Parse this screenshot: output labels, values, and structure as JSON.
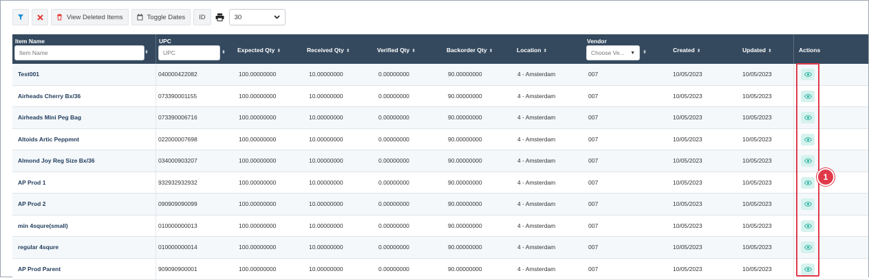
{
  "toolbar": {
    "filter_icon": "filter-icon",
    "clear_icon": "close-icon",
    "view_deleted_label": "View Deleted Items",
    "toggle_dates_label": "Toggle Dates",
    "id_label": "ID",
    "page_size_value": "30"
  },
  "columns": {
    "item_name": "Item Name",
    "item_name_placeholder": "Item Name",
    "upc": "UPC",
    "upc_placeholder": "UPC",
    "expected_qty": "Expected Qty",
    "received_qty": "Received Qty",
    "verified_qty": "Verified Qty",
    "backorder_qty": "Backorder Qty",
    "location": "Location",
    "vendor": "Vendor",
    "vendor_placeholder": "Choose Ve...",
    "created": "Created",
    "updated": "Updated",
    "actions": "Actions"
  },
  "rows": [
    {
      "name": "Test001",
      "upc": "040000422082",
      "expected": "100.00000000",
      "received": "10.00000000",
      "verified": "0.00000000",
      "backorder": "90.00000000",
      "location": "4 - Amsterdam",
      "vendor": "007",
      "created": "10/05/2023",
      "updated": "10/05/2023"
    },
    {
      "name": "Airheads Cherry Bx/36",
      "upc": "073390001155",
      "expected": "100.00000000",
      "received": "10.00000000",
      "verified": "0.00000000",
      "backorder": "90.00000000",
      "location": "4 - Amsterdam",
      "vendor": "007",
      "created": "10/05/2023",
      "updated": "10/05/2023"
    },
    {
      "name": "Airheads Mini Peg Bag",
      "upc": "073390006716",
      "expected": "100.00000000",
      "received": "10.00000000",
      "verified": "0.00000000",
      "backorder": "90.00000000",
      "location": "4 - Amsterdam",
      "vendor": "007",
      "created": "10/05/2023",
      "updated": "10/05/2023"
    },
    {
      "name": "Altoids Artic Peppmnt",
      "upc": "022000007698",
      "expected": "100.00000000",
      "received": "10.00000000",
      "verified": "0.00000000",
      "backorder": "90.00000000",
      "location": "4 - Amsterdam",
      "vendor": "007",
      "created": "10/05/2023",
      "updated": "10/05/2023"
    },
    {
      "name": "Almond Joy Reg Size Bx/36",
      "upc": "034000903207",
      "expected": "100.00000000",
      "received": "10.00000000",
      "verified": "0.00000000",
      "backorder": "90.00000000",
      "location": "4 - Amsterdam",
      "vendor": "007",
      "created": "10/05/2023",
      "updated": "10/05/2023"
    },
    {
      "name": "AP Prod 1",
      "upc": "932932932932",
      "expected": "100.00000000",
      "received": "10.00000000",
      "verified": "0.00000000",
      "backorder": "90.00000000",
      "location": "4 - Amsterdam",
      "vendor": "007",
      "created": "10/05/2023",
      "updated": "10/05/2023"
    },
    {
      "name": "AP Prod 2",
      "upc": "090909090099",
      "expected": "100.00000000",
      "received": "10.00000000",
      "verified": "0.00000000",
      "backorder": "90.00000000",
      "location": "4 - Amsterdam",
      "vendor": "007",
      "created": "10/05/2023",
      "updated": "10/05/2023"
    },
    {
      "name": "min 4squre(small)",
      "upc": "010000000013",
      "expected": "100.00000000",
      "received": "10.00000000",
      "verified": "0.00000000",
      "backorder": "90.00000000",
      "location": "4 - Amsterdam",
      "vendor": "007",
      "created": "10/05/2023",
      "updated": "10/05/2023"
    },
    {
      "name": "regular 4squre",
      "upc": "010000000014",
      "expected": "100.00000000",
      "received": "10.00000000",
      "verified": "0.00000000",
      "backorder": "90.00000000",
      "location": "4 - Amsterdam",
      "vendor": "007",
      "created": "10/05/2023",
      "updated": "10/05/2023"
    },
    {
      "name": "AP Prod Parent",
      "upc": "909090900001",
      "expected": "100.00000000",
      "received": "10.00000000",
      "verified": "0.00000000",
      "backorder": "90.00000000",
      "location": "4 - Amsterdam",
      "vendor": "007",
      "created": "10/05/2023",
      "updated": "10/05/2023"
    }
  ],
  "row_action_icon": "eye-icon",
  "annotation": {
    "badge_number": "1"
  },
  "colors": {
    "header_bg": "#34495e",
    "highlight": "#e0394a",
    "eye_bg": "#d6f2ee",
    "eye_icon": "#2fb5a2",
    "filter_icon": "#1b8fd6",
    "clear_icon": "#e53935"
  }
}
